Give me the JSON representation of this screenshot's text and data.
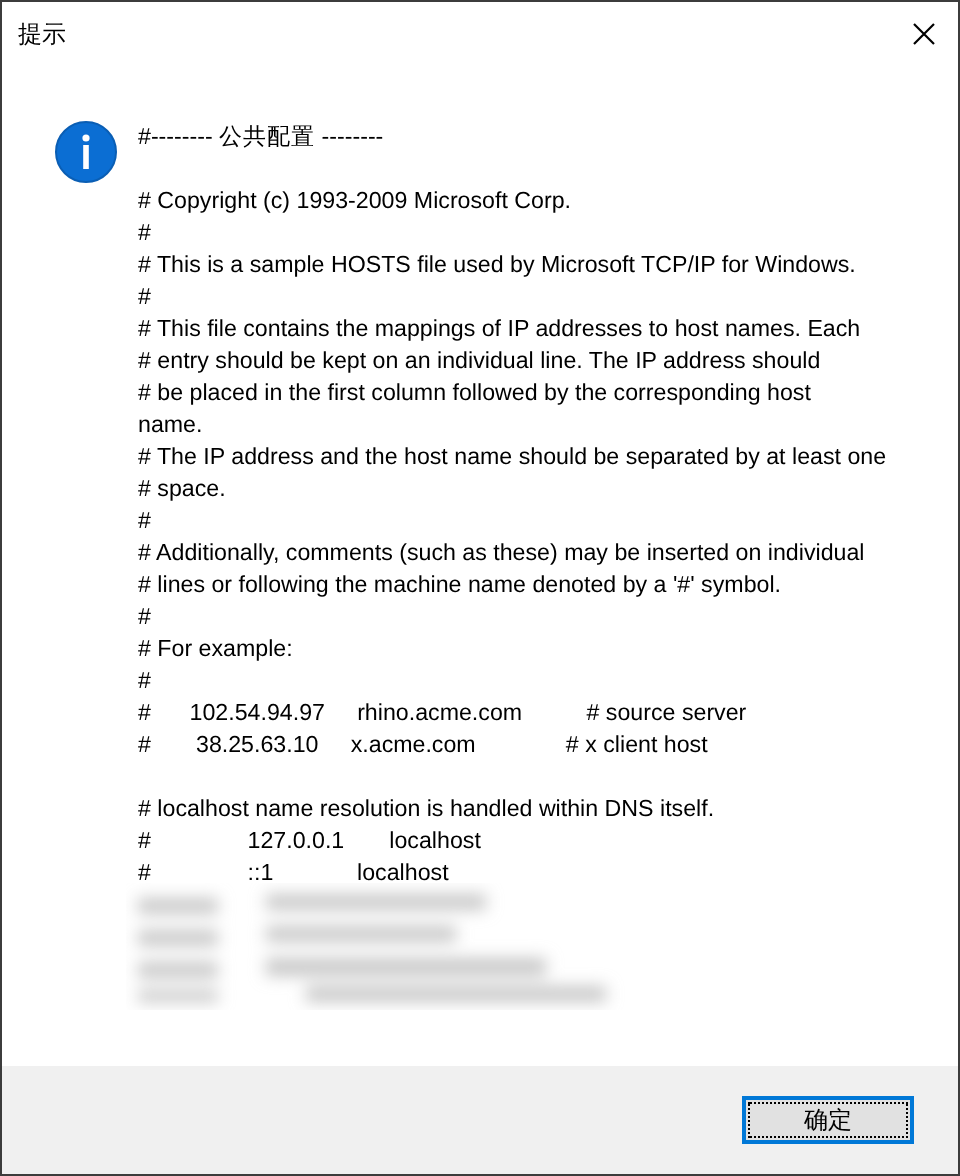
{
  "window": {
    "title": "提示"
  },
  "message": {
    "blocks": [
      [
        "#-------- 公共配置 --------"
      ],
      [
        "# Copyright (c) 1993-2009 Microsoft Corp.",
        "#",
        "# This is a sample HOSTS file used by Microsoft TCP/IP for Windows.",
        "#",
        "# This file contains the mappings of IP addresses to host names. Each",
        "# entry should be kept on an individual line. The IP address should",
        "# be placed in the first column followed by the corresponding host",
        "name.",
        "# The IP address and the host name should be separated by at least one",
        "# space.",
        "#",
        "# Additionally, comments (such as these) may be inserted on individual",
        "# lines or following the machine name denoted by a '#' symbol.",
        "#",
        "# For example:",
        "#",
        "#      102.54.94.97     rhino.acme.com          # source server",
        "#       38.25.63.10     x.acme.com              # x client host"
      ],
      [
        "# localhost name resolution is handled within DNS itself.",
        "#               127.0.0.1       localhost",
        "#               ::1             localhost"
      ]
    ],
    "blurred": true
  },
  "buttons": [
    {
      "label": "确定",
      "selected": true
    }
  ]
}
